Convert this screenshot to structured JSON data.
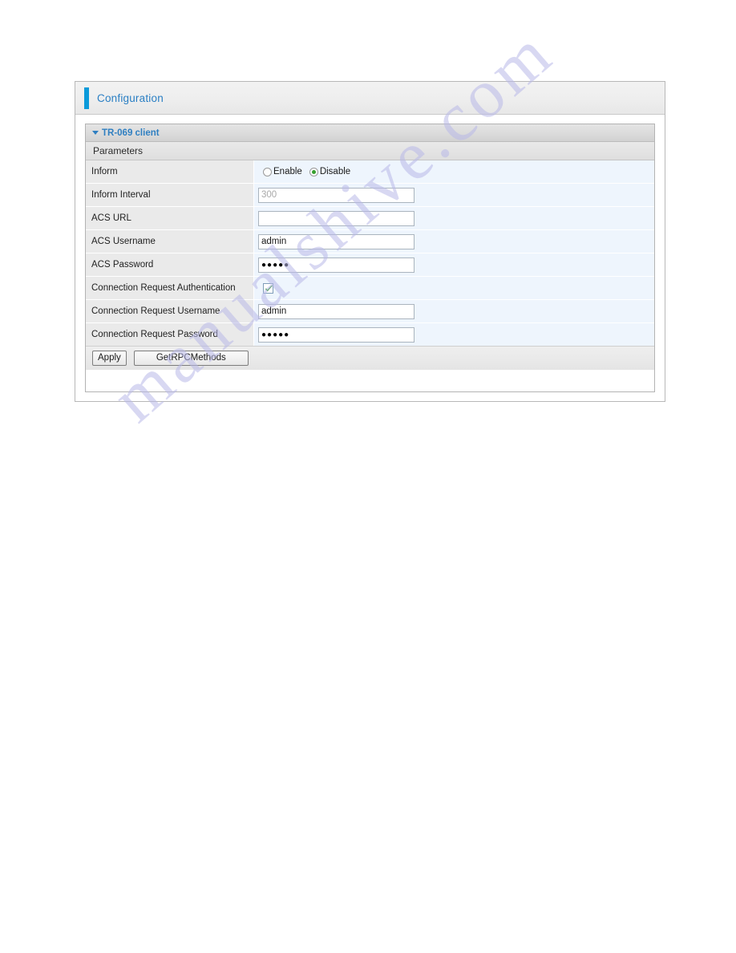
{
  "watermark": {
    "text": "manualshive.com"
  },
  "header": {
    "title": "Configuration",
    "accent_color": "#0a9ada",
    "title_color": "#2a7fc4"
  },
  "section": {
    "title": "TR-069 client",
    "caret_icon": "caret-down-icon",
    "subheader": "Parameters"
  },
  "rows": [
    {
      "label": "Inform",
      "type": "radio",
      "options": [
        {
          "label": "Enable",
          "selected": false
        },
        {
          "label": "Disable",
          "selected": true
        }
      ]
    },
    {
      "label": "Inform Interval",
      "type": "text",
      "value": "300",
      "muted": true
    },
    {
      "label": "ACS URL",
      "type": "text",
      "value": "",
      "muted": false
    },
    {
      "label": "ACS Username",
      "type": "text",
      "value": "admin",
      "muted": false
    },
    {
      "label": "ACS Password",
      "type": "password",
      "value": "●●●●●",
      "muted": false
    },
    {
      "label": "Connection Request Authentication",
      "type": "checkbox",
      "checked": true
    },
    {
      "label": "Connection Request Username",
      "type": "text",
      "value": "admin",
      "muted": false
    },
    {
      "label": "Connection Request Password",
      "type": "password",
      "value": "●●●●●",
      "muted": false
    }
  ],
  "buttons": {
    "apply": "Apply",
    "get_rpc_methods": "GetRPCMethods"
  },
  "colors": {
    "accent_blue": "#0a9ada",
    "link_blue": "#2f7fc1",
    "row_value_bg": "#eef5fd",
    "row_label_bg": "#eaeaea",
    "check_green": "#37a02e"
  }
}
